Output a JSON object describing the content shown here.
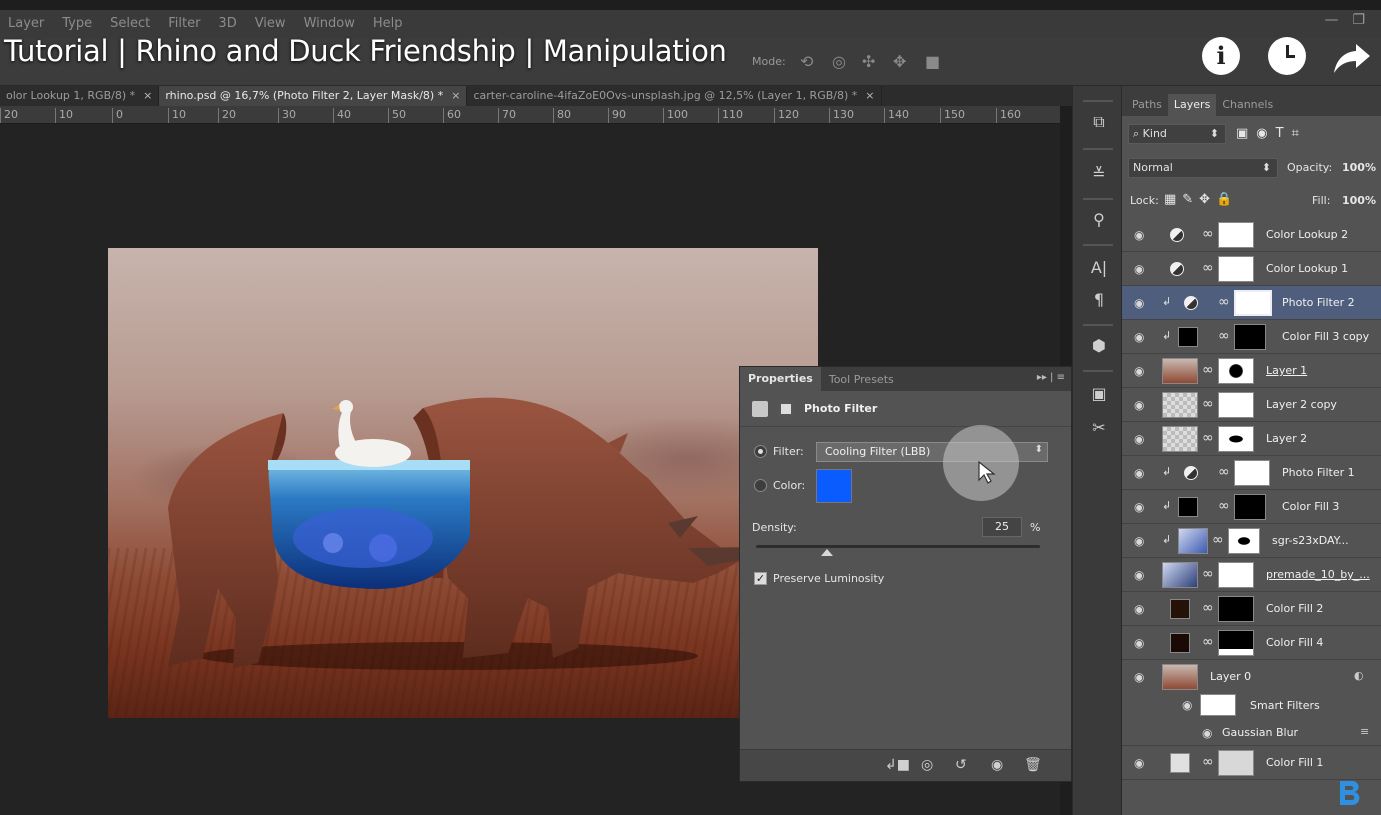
{
  "menu": {
    "items": [
      "Layer",
      "Type",
      "Select",
      "Filter",
      "3D",
      "View",
      "Window",
      "Help"
    ]
  },
  "options_bar": {
    "mode_label": "Mode:"
  },
  "video": {
    "title": "Tutorial | Rhino and Duck Friendship | Manipulation",
    "info_glyph": "i"
  },
  "tabs": [
    {
      "label": "olor Lookup 1, RGB/8) *",
      "close": "×"
    },
    {
      "label": "rhino.psd @ 16,7% (Photo Filter 2, Layer Mask/8) *",
      "close": "×"
    },
    {
      "label": "carter-caroline-4ifaZoE0Ovs-unsplash.jpg @ 12,5% (Layer 1, RGB/8) *",
      "close": "×"
    }
  ],
  "ruler": [
    "20",
    "10",
    "0",
    "10",
    "20",
    "30",
    "40",
    "50",
    "60",
    "70",
    "80",
    "90",
    "100",
    "110",
    "120",
    "130",
    "140",
    "150",
    "160"
  ],
  "properties": {
    "tab_active": "Properties",
    "tab_other": "Tool Presets",
    "panel_title": "Photo Filter",
    "filter_label": "Filter:",
    "filter_value": "Cooling Filter (LBB)",
    "color_label": "Color:",
    "color_value": "#0a5cff",
    "density_label": "Density:",
    "density_value": "25",
    "density_unit": "%",
    "preserve_label": "Preserve Luminosity",
    "preserve_checked": true
  },
  "layers_panel": {
    "tabs": [
      "Paths",
      "Layers",
      "Channels"
    ],
    "active_tab": "Layers",
    "kind_label": "Kind",
    "blend_mode": "Normal",
    "opacity_label": "Opacity:",
    "opacity_value": "100%",
    "lock_label": "Lock:",
    "fill_label": "Fill:",
    "fill_value": "100%",
    "layers": [
      {
        "name": "Color Lookup 2",
        "selected": false
      },
      {
        "name": "Color Lookup 1",
        "selected": false
      },
      {
        "name": "Photo Filter 2",
        "selected": true
      },
      {
        "name": "Color Fill 3 copy",
        "selected": false
      },
      {
        "name": "Layer 1",
        "selected": false
      },
      {
        "name": "Layer 2 copy",
        "selected": false
      },
      {
        "name": "Layer 2",
        "selected": false
      },
      {
        "name": "Photo Filter 1",
        "selected": false
      },
      {
        "name": "Color Fill 3",
        "selected": false
      },
      {
        "name": "sgr-s23xDAY...",
        "selected": false
      },
      {
        "name": "premade_10_by_...",
        "selected": false
      },
      {
        "name": "Color Fill 2",
        "selected": false
      },
      {
        "name": "Color Fill 4",
        "selected": false
      },
      {
        "name": "Layer 0",
        "selected": false
      }
    ],
    "smart_filters_label": "Smart Filters",
    "gaussian_blur_label": "Gaussian Blur",
    "last_layer": "Color Fill 1"
  },
  "colors": {
    "selected_layer": "#4f5e7c",
    "panel_bg": "#535353",
    "canvas_bg": "#232323"
  }
}
